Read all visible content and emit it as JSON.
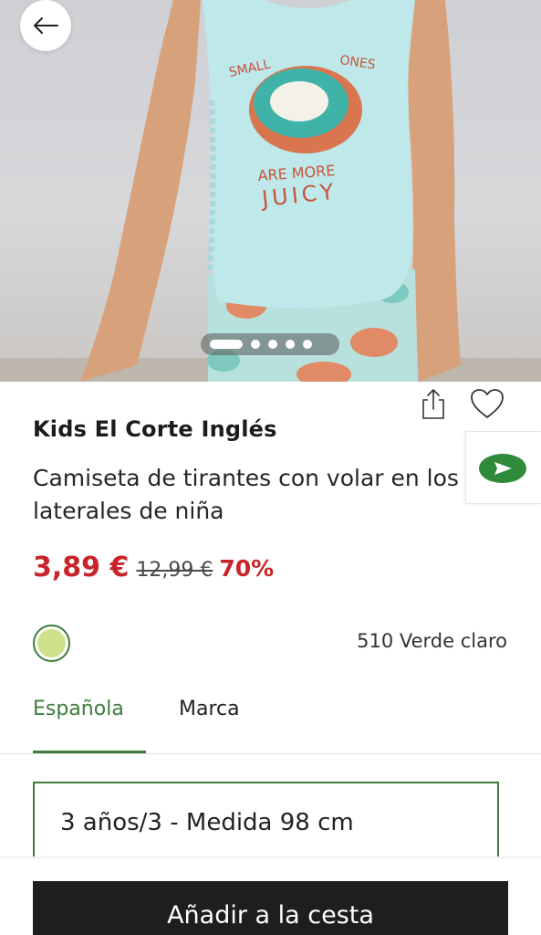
{
  "hero": {
    "shirt_text_line1_left": "SMALL",
    "shirt_text_line1_right": "ONES",
    "shirt_text_line2": "ARE MORE",
    "shirt_text_line3": "JUICY",
    "pager": {
      "total": 5,
      "active_index": 0
    }
  },
  "product": {
    "brand": "Kids El Corte Inglés",
    "title": "Camiseta de tirantes con volar en los laterales de niña",
    "price": {
      "current": "3,89 €",
      "original": "12,99 €",
      "discount": "70%"
    },
    "color": {
      "name": "510 Verde claro",
      "swatch_hex": "#cfe08a"
    }
  },
  "tabs": [
    {
      "label": "Española",
      "active": true
    },
    {
      "label": "Marca",
      "active": false
    }
  ],
  "size_select": {
    "value": "3 años/3 - Medida 98 cm"
  },
  "cta": {
    "add_to_cart": "Añadir a la cesta"
  },
  "icons": {
    "back": "arrow-left-icon",
    "share": "share-icon",
    "favorite": "heart-icon",
    "chat": "send-icon"
  },
  "colors": {
    "accent_green": "#3e7d3c",
    "price_red": "#c8252a",
    "cta_bg": "#1e1e1e"
  }
}
